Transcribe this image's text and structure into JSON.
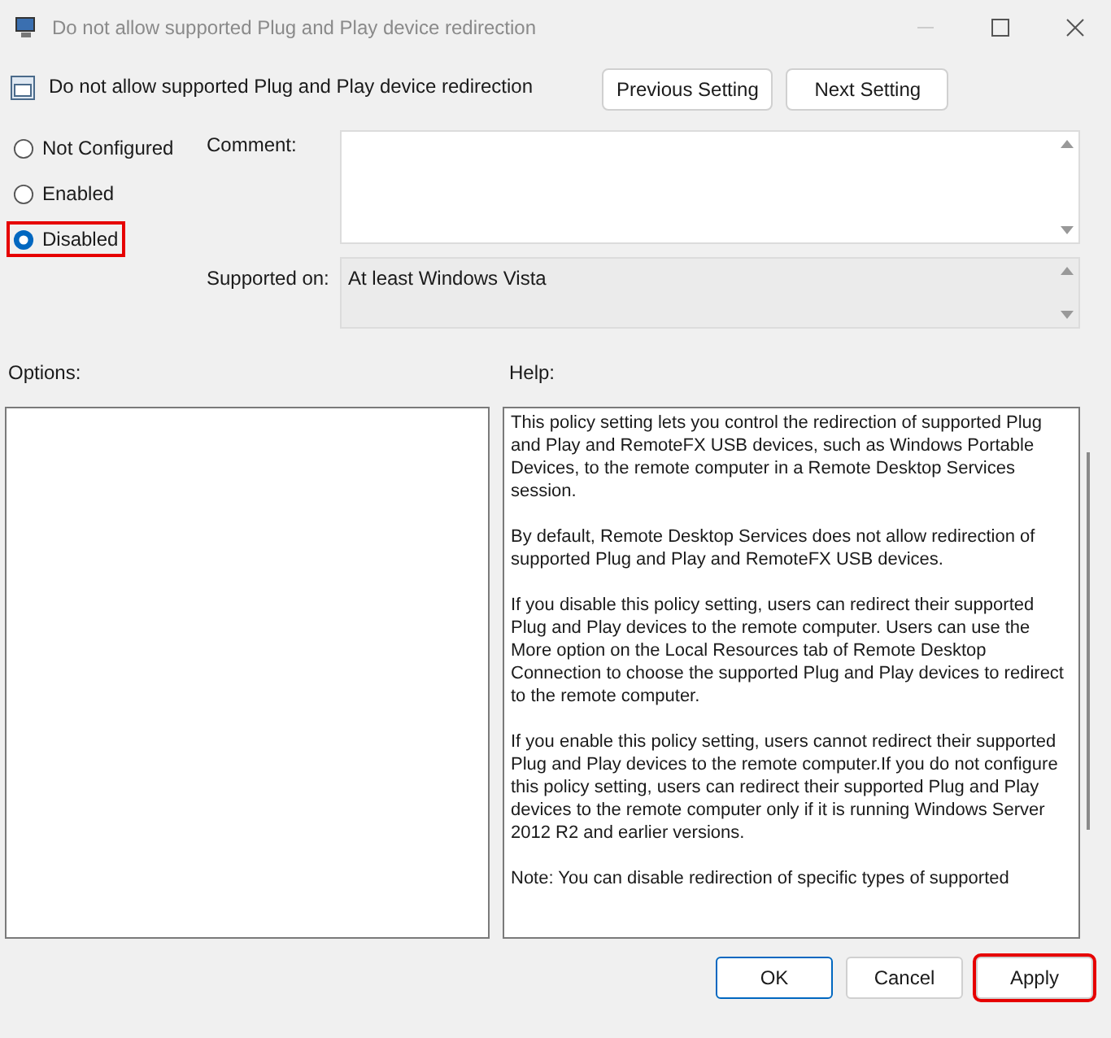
{
  "window": {
    "title": "Do not allow supported Plug and Play device redirection"
  },
  "header": {
    "title": "Do not allow supported Plug and Play device redirection",
    "buttons": [
      "Previous Setting",
      "Next Setting"
    ]
  },
  "state_options": [
    {
      "label": "Not Configured",
      "selected": false,
      "highlighted": false
    },
    {
      "label": "Enabled",
      "selected": false,
      "highlighted": false
    },
    {
      "label": "Disabled",
      "selected": true,
      "highlighted": true
    }
  ],
  "comment": {
    "label": "Comment:"
  },
  "supported_on": {
    "label": "Supported on:",
    "value": "At least Windows Vista"
  },
  "options": {
    "label": "Options:"
  },
  "help": {
    "label": "Help:",
    "paragraphs": [
      "This policy setting lets you control the redirection of supported Plug and Play and RemoteFX USB devices, such as Windows Portable Devices, to the remote computer in a Remote Desktop Services session.",
      "By default, Remote Desktop Services does not allow redirection of supported Plug and Play and RemoteFX USB devices.",
      "If you disable this policy setting, users can redirect their supported Plug and Play devices to the remote computer. Users can use the More option on the Local Resources tab of Remote Desktop Connection to choose the supported Plug and Play devices to redirect to the remote computer.",
      "If you enable this policy setting, users cannot redirect their supported Plug and Play devices to the remote computer.If you do not configure this policy setting, users can redirect their supported Plug and Play devices to the remote computer only if it is running Windows Server 2012 R2 and earlier versions.",
      "Note: You can disable redirection of specific types of supported"
    ]
  },
  "footer_buttons": [
    {
      "label": "OK",
      "kind": "default",
      "highlighted": false
    },
    {
      "label": "Cancel",
      "kind": "normal",
      "highlighted": false
    },
    {
      "label": "Apply",
      "kind": "normal",
      "highlighted": true
    }
  ]
}
